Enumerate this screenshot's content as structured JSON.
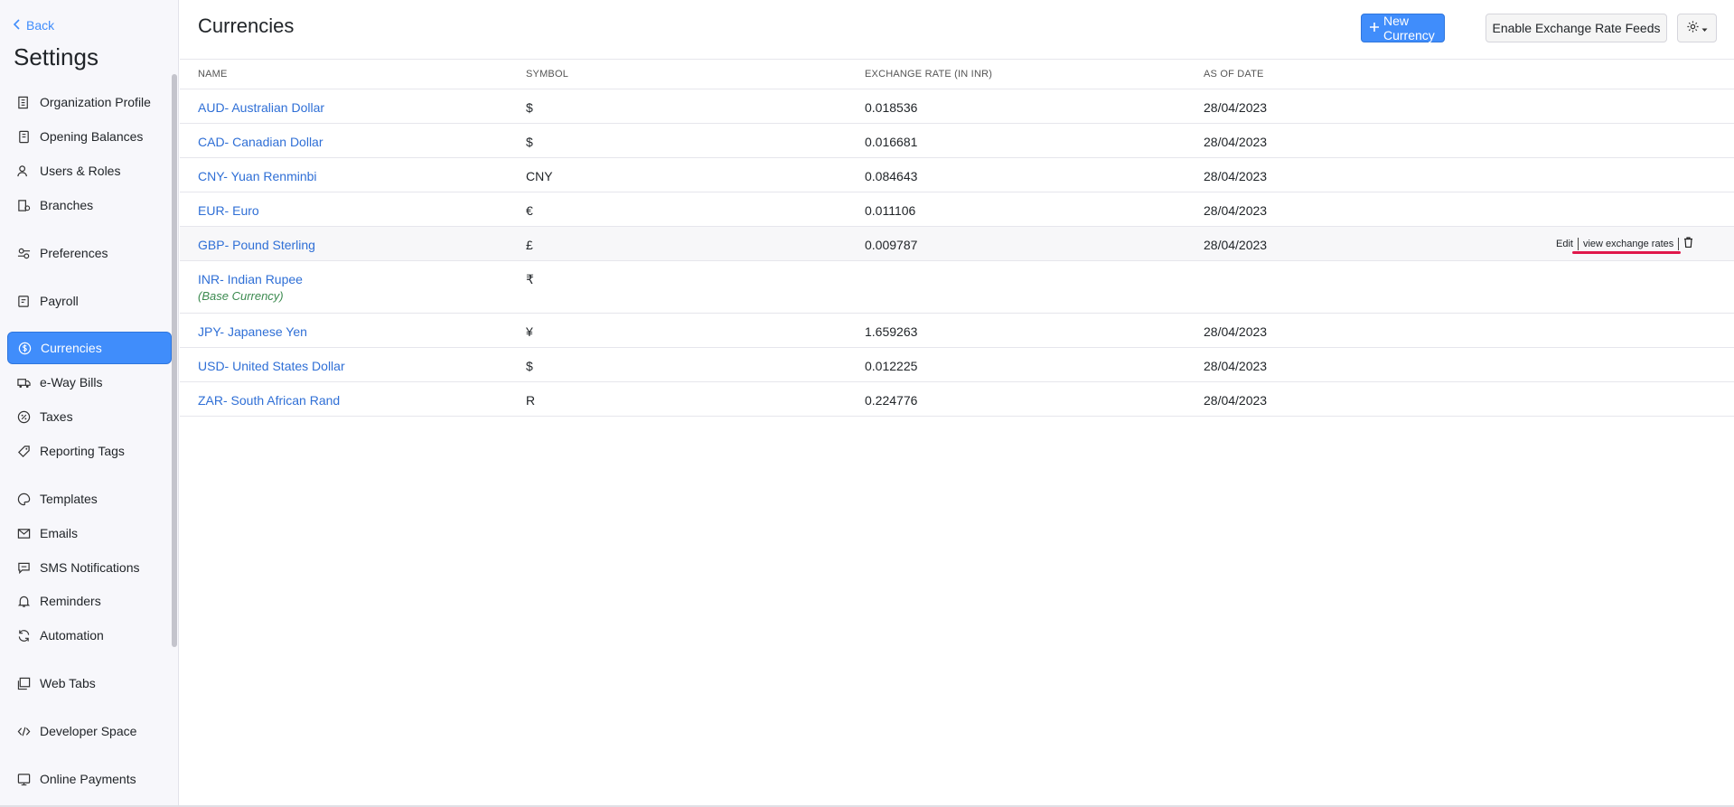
{
  "sidebar": {
    "back_label": "Back",
    "title": "Settings",
    "items": [
      {
        "label": "Organization Profile",
        "icon": "building-icon",
        "active": false
      },
      {
        "label": "Opening Balances",
        "icon": "ledger-icon",
        "active": false
      },
      {
        "label": "Users & Roles",
        "icon": "users-icon",
        "active": false
      },
      {
        "label": "Branches",
        "icon": "branch-icon",
        "active": false
      },
      {
        "label": "Preferences",
        "icon": "preferences-icon",
        "active": false
      },
      {
        "label": "Payroll",
        "icon": "payroll-icon",
        "active": false
      },
      {
        "label": "Currencies",
        "icon": "currency-icon",
        "active": true
      },
      {
        "label": "e-Way Bills",
        "icon": "truck-icon",
        "active": false
      },
      {
        "label": "Taxes",
        "icon": "percent-icon",
        "active": false
      },
      {
        "label": "Reporting Tags",
        "icon": "tag-icon",
        "active": false
      },
      {
        "label": "Templates",
        "icon": "palette-icon",
        "active": false
      },
      {
        "label": "Emails",
        "icon": "mail-icon",
        "active": false
      },
      {
        "label": "SMS Notifications",
        "icon": "sms-icon",
        "active": false
      },
      {
        "label": "Reminders",
        "icon": "bell-icon",
        "active": false
      },
      {
        "label": "Automation",
        "icon": "refresh-icon",
        "active": false
      },
      {
        "label": "Web Tabs",
        "icon": "tabs-icon",
        "active": false
      },
      {
        "label": "Developer Space",
        "icon": "code-icon",
        "active": false
      },
      {
        "label": "Online Payments",
        "icon": "payment-icon",
        "active": false
      }
    ]
  },
  "header": {
    "title": "Currencies",
    "new_button": "New Currency",
    "feeds_button": "Enable Exchange Rate Feeds",
    "gear_icon": "gear-icon"
  },
  "table": {
    "columns": [
      "NAME",
      "SYMBOL",
      "EXCHANGE RATE (IN INR)",
      "AS OF DATE"
    ],
    "rows": [
      {
        "name": "AUD- Australian Dollar",
        "symbol": "$",
        "rate": "0.018536",
        "date": "28/04/2023"
      },
      {
        "name": "CAD- Canadian Dollar",
        "symbol": "$",
        "rate": "0.016681",
        "date": "28/04/2023"
      },
      {
        "name": "CNY- Yuan Renminbi",
        "symbol": "CNY",
        "rate": "0.084643",
        "date": "28/04/2023"
      },
      {
        "name": "EUR- Euro",
        "symbol": "€",
        "rate": "0.011106",
        "date": "28/04/2023"
      },
      {
        "name": "GBP- Pound Sterling",
        "symbol": "£",
        "rate": "0.009787",
        "date": "28/04/2023"
      },
      {
        "name": "INR- Indian Rupee",
        "symbol": "₹",
        "rate": "",
        "date": "",
        "note": "(Base Currency)"
      },
      {
        "name": "JPY- Japanese Yen",
        "symbol": "¥",
        "rate": "1.659263",
        "date": "28/04/2023"
      },
      {
        "name": "USD- United States Dollar",
        "symbol": "$",
        "rate": "0.012225",
        "date": "28/04/2023"
      },
      {
        "name": "ZAR- South African Rand",
        "symbol": "R",
        "rate": "0.224776",
        "date": "28/04/2023"
      }
    ],
    "row_actions": {
      "edit": "Edit",
      "view_rates": "view exchange rates",
      "delete_icon": "trash-icon"
    }
  },
  "colors": {
    "accent": "#408dfb",
    "link": "#2f6fd6",
    "base_note": "#3b8a4f",
    "annotation": "#e0174a"
  }
}
